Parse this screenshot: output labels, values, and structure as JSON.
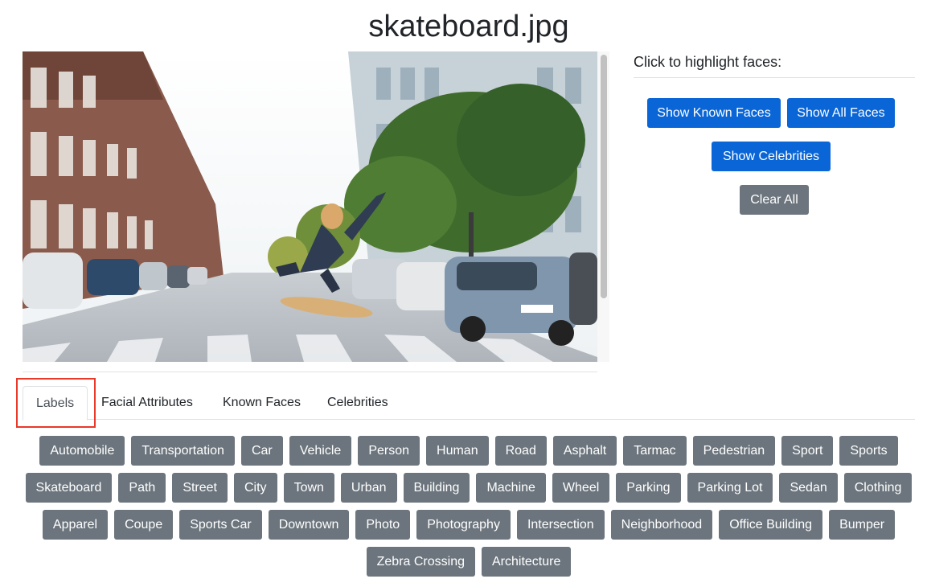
{
  "page": {
    "title": "skateboard.jpg"
  },
  "panel": {
    "heading": "Click to highlight faces:",
    "buttons": {
      "known_faces": "Show Known Faces",
      "all_faces": "Show All Faces",
      "celebrities": "Show Celebrities",
      "clear_all": "Clear All"
    },
    "colors": {
      "primary": "#0a66d6",
      "secondary": "#6c757d"
    }
  },
  "tabs": [
    {
      "label": "Labels",
      "active": true
    },
    {
      "label": "Facial Attributes",
      "active": false
    },
    {
      "label": "Known Faces",
      "active": false
    },
    {
      "label": "Celebrities",
      "active": false
    }
  ],
  "labels": [
    "Automobile",
    "Transportation",
    "Car",
    "Vehicle",
    "Person",
    "Human",
    "Road",
    "Asphalt",
    "Tarmac",
    "Pedestrian",
    "Sport",
    "Sports",
    "Skateboard",
    "Path",
    "Street",
    "City",
    "Town",
    "Urban",
    "Building",
    "Machine",
    "Wheel",
    "Parking",
    "Parking Lot",
    "Sedan",
    "Clothing",
    "Apparel",
    "Coupe",
    "Sports Car",
    "Downtown",
    "Photo",
    "Photography",
    "Intersection",
    "Neighborhood",
    "Office Building",
    "Bumper",
    "Zebra Crossing",
    "Architecture"
  ],
  "highlight_color": "#e8392b"
}
